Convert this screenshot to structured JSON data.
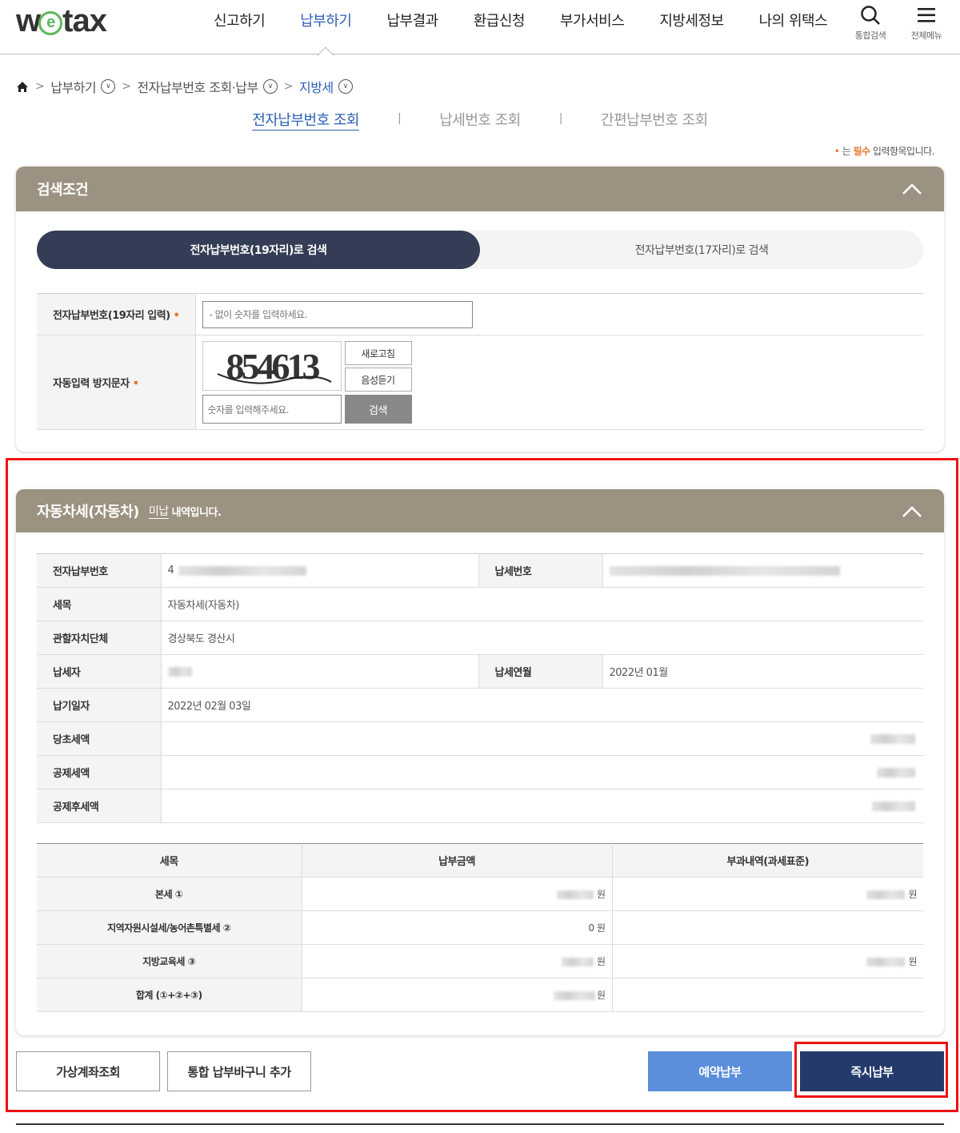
{
  "header": {
    "logo_pre": "w",
    "logo_e": "e",
    "logo_post": "tax",
    "nav": [
      "신고하기",
      "납부하기",
      "납부결과",
      "환급신청",
      "부가서비스",
      "지방세정보",
      "나의 위택스"
    ],
    "search_label": "통합검색",
    "menu_label": "전체메뉴"
  },
  "breadcrumb": [
    "납부하기",
    "전자납부번호 조회·납부",
    "지방세"
  ],
  "subtabs": [
    "전자납부번호 조회",
    "납세번호 조회",
    "간편납부번호 조회"
  ],
  "subtab_divider": "|",
  "required_note": {
    "dot": "•",
    "pre": "는",
    "strong": "필수",
    "post": "입력항목입니다."
  },
  "search_panel": {
    "title": "검색조건",
    "toggle_on": "전자납부번호(19자리)로 검색",
    "toggle_off": "전자납부번호(17자리)로 검색",
    "required_mark": "•",
    "field1_label": "전자납부번호(19자리 입력)",
    "field1_placeholder": "- 없이 숫자를 입력하세요.",
    "field2_label": "자동입력 방지문자",
    "captcha_text": "854613",
    "refresh_btn": "새로고침",
    "audio_btn": "음성듣기",
    "captcha_placeholder": "숫자를 입력해주세요.",
    "search_btn": "검색"
  },
  "result_panel": {
    "title": "자동차세(자동차)",
    "status": "미납",
    "title_suffix": "내역입니다.",
    "labels": {
      "enum": "전자납부번호",
      "taxnum": "납세번호",
      "item": "세목",
      "gov": "관할자치단체",
      "payer": "납세자",
      "ym": "납세연월",
      "due": "납기일자",
      "orig": "당초세액",
      "deduct": "공제세액",
      "after": "공제후세액"
    },
    "values": {
      "enum_prefix": "4",
      "item": "자동차세(자동차)",
      "gov": "경상북도 경산시",
      "ym": "2022년 01월",
      "due": "2022년 02월 03일"
    },
    "tax_table": {
      "headers": [
        "세목",
        "납부금액",
        "부과내역(과세표준)"
      ],
      "rows": [
        {
          "label": "본세 ①",
          "amount": "원",
          "base": "원"
        },
        {
          "label": "지역자원시설세/농어촌특별세 ②",
          "amount": "0 원",
          "base": ""
        },
        {
          "label": "지방교육세 ③",
          "amount": "원",
          "base": "원"
        },
        {
          "label": "합계 (①+②+③)",
          "amount": "원",
          "base": ""
        }
      ]
    }
  },
  "buttons": {
    "virtual_account": "가상계좌조회",
    "add_cart": "통합 납부바구니 추가",
    "reserve_pay": "예약납부",
    "pay_now": "즉시납부"
  }
}
